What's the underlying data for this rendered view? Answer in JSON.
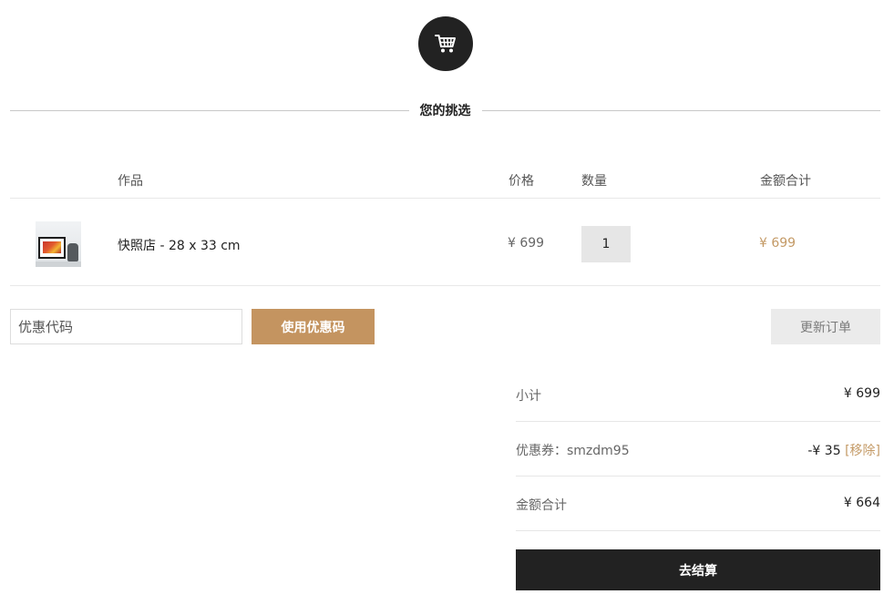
{
  "header": {
    "cart_icon": "cart-icon",
    "title": "您的挑选"
  },
  "table": {
    "columns": {
      "product": "作品",
      "price": "价格",
      "quantity": "数量",
      "total": "金额合计"
    },
    "rows": [
      {
        "name": "快照店 - 28 x 33 cm",
        "price": "¥ 699",
        "quantity": "1",
        "total": "¥ 699"
      }
    ]
  },
  "coupon": {
    "placeholder": "优惠代码",
    "apply_label": "使用优惠码",
    "update_label": "更新订单"
  },
  "totals": {
    "subtotal_label": "小计",
    "subtotal_value": "¥ 699",
    "coupon_label": "优惠券：smzdm95",
    "coupon_value": "-¥ 35",
    "coupon_remove": "[移除]",
    "total_label": "金额合计",
    "total_value": "¥ 664",
    "checkout_label": "去结算"
  },
  "colors": {
    "accent": "#c49460",
    "dark": "#222222",
    "muted_button": "#ebebeb"
  }
}
